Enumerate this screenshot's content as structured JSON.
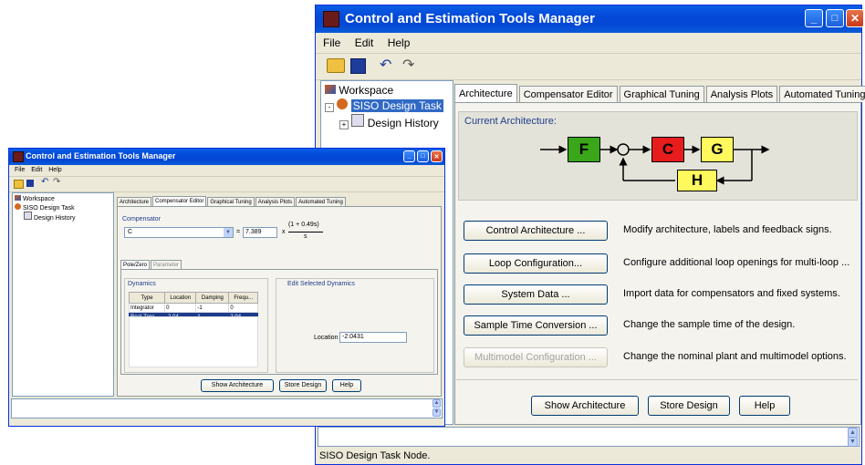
{
  "large_window": {
    "title": "Control and Estimation Tools Manager",
    "menu": [
      "File",
      "Edit",
      "Help"
    ],
    "tree": {
      "root": "Workspace",
      "task": "SISO Design Task",
      "child": "Design History"
    },
    "tabs": [
      "Architecture",
      "Compensator Editor",
      "Graphical Tuning",
      "Analysis Plots",
      "Automated Tuning"
    ],
    "current_architecture_label": "Current Architecture:",
    "blocks": {
      "f": "F",
      "c": "C",
      "g": "G",
      "h": "H"
    },
    "block_colors": {
      "f": "#3aa61a",
      "c": "#e81c1c",
      "g": "#fff95e",
      "h": "#fff95e"
    },
    "actions": [
      {
        "label": "Control Architecture ...",
        "description": "Modify architecture, labels and feedback signs."
      },
      {
        "label": "Loop Configuration...",
        "description": "Configure additional loop openings for multi-loop ..."
      },
      {
        "label": "System Data ...",
        "description": "Import data for compensators and fixed systems."
      },
      {
        "label": "Sample Time Conversion ...",
        "description": "Change the sample time of the design."
      },
      {
        "label": "Multimodel Configuration ...",
        "description": "Change the nominal plant and multimodel options."
      }
    ],
    "bottom_buttons": [
      "Show Architecture",
      "Store Design",
      "Help"
    ],
    "status": "SISO Design Task Node."
  },
  "small_window": {
    "title": "Control and Estimation Tools Manager",
    "menu": [
      "File",
      "Edit",
      "Help"
    ],
    "tree": {
      "root": "Workspace",
      "task": "SISO Design Task",
      "child": "Design History"
    },
    "tabs": [
      "Architecture",
      "Compensator Editor",
      "Graphical Tuning",
      "Analysis Plots",
      "Automated Tuning"
    ],
    "compensator_label": "Compensator",
    "compensator_name": "C",
    "gain": "7.389",
    "numerator": "(1 + 0.49s)",
    "denominator": "s",
    "equals": "=",
    "times": "x",
    "subtabs": [
      "Pole/Zero",
      "Parameter"
    ],
    "dynamics_label": "Dynamics",
    "edit_dynamics_label": "Edit Selected Dynamics",
    "table": {
      "headers": [
        "Type",
        "Location",
        "Damping",
        "Frequ..."
      ],
      "rows": [
        [
          "Integrator",
          "0",
          "-1",
          "0"
        ],
        [
          "Real Zero",
          "-2.04",
          "1",
          "2.04"
        ]
      ]
    },
    "location_label": "Location",
    "location_value": "-2.0431",
    "bottom_buttons": [
      "Show Architecture",
      "Store Design",
      "Help"
    ]
  }
}
